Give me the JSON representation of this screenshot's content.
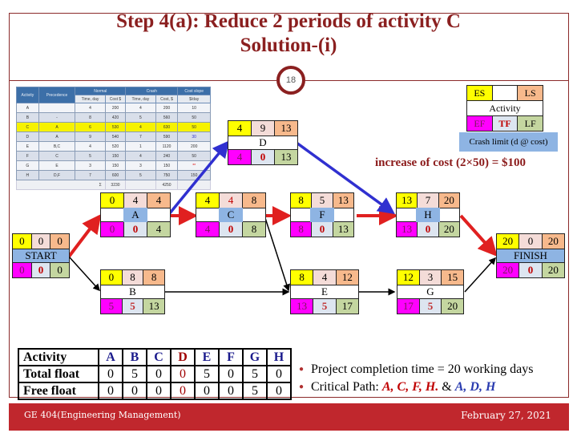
{
  "title": {
    "line1": "Step 4(a): Reduce 2 periods of activity C",
    "line2": "Solution-(i)"
  },
  "slide_number": "18",
  "cost_table": {
    "headers": [
      "Activity",
      "Precedence",
      "Normal",
      "Crash",
      "Cost slope"
    ],
    "subheaders": [
      "Time, day",
      "Cost $",
      "Time, day",
      "Cost, $",
      "$/day"
    ],
    "rows": [
      {
        "activity": "A",
        "precedence": "",
        "n_time": "4",
        "n_cost": "200",
        "c_time": "4",
        "c_cost": "200",
        "slope": "10"
      },
      {
        "activity": "B",
        "precedence": "-",
        "n_time": "8",
        "n_cost": "420",
        "c_time": "5",
        "c_cost": "560",
        "slope": "50"
      },
      {
        "activity": "C",
        "precedence": "A",
        "n_time": "6",
        "n_cost": "530",
        "c_time": "4",
        "c_cost": "630",
        "slope": "50"
      },
      {
        "activity": "D",
        "precedence": "A",
        "n_time": "9",
        "n_cost": "540",
        "c_time": "7",
        "c_cost": "590",
        "slope": "30"
      },
      {
        "activity": "E",
        "precedence": "B,C",
        "n_time": "4",
        "n_cost": "520",
        "c_time": "1",
        "c_cost": "1120",
        "slope": "200"
      },
      {
        "activity": "F",
        "precedence": "C",
        "n_time": "5",
        "n_cost": "150",
        "c_time": "4",
        "c_cost": "240",
        "slope": "50"
      },
      {
        "activity": "G",
        "precedence": "E",
        "n_time": "3",
        "n_cost": "150",
        "c_time": "3",
        "c_cost": "150",
        "slope": "**"
      },
      {
        "activity": "H",
        "precedence": "D,F",
        "n_time": "7",
        "n_cost": "600",
        "c_time": "5",
        "c_cost": "750",
        "slope": "150"
      }
    ],
    "total_label": "Σ",
    "total_normal": "3230",
    "total_crash": "4250"
  },
  "legend": {
    "es": "ES",
    "ls": "LS",
    "activity": "Activity",
    "ef": "EF",
    "tf": "TF",
    "lf": "LF",
    "crash_limit": "Crash limit (d @ cost)"
  },
  "cost_note": "increase of cost (2×50) = $100",
  "nodes": {
    "start": {
      "name": "START",
      "es": "0",
      "dur": "0",
      "ls": "0",
      "ef": "0",
      "tf": "0",
      "lf": "0"
    },
    "A": {
      "name": "A",
      "es": "0",
      "dur": "4",
      "ls": "4",
      "ef": "0",
      "tf": "0",
      "lf": "4"
    },
    "C": {
      "name": "C",
      "es": "4",
      "dur": "4",
      "ls": "8",
      "ef": "4",
      "tf": "0",
      "lf": "8"
    },
    "D": {
      "name": "D",
      "es": "4",
      "dur": "9",
      "ls": "13",
      "ef": "4",
      "tf": "0",
      "lf": "13"
    },
    "F": {
      "name": "F",
      "es": "8",
      "dur": "5",
      "ls": "13",
      "ef": "8",
      "tf": "0",
      "lf": "13"
    },
    "H": {
      "name": "H",
      "es": "13",
      "dur": "7",
      "ls": "20",
      "ef": "13",
      "tf": "0",
      "lf": "20"
    },
    "B": {
      "name": "B",
      "es": "0",
      "dur": "8",
      "ls": "8",
      "ef": "5",
      "tf": "5",
      "lf": "13"
    },
    "E": {
      "name": "E",
      "es": "8",
      "dur": "4",
      "ls": "12",
      "ef": "13",
      "tf": "5",
      "lf": "17"
    },
    "G": {
      "name": "G",
      "es": "12",
      "dur": "3",
      "ls": "15",
      "ef": "17",
      "tf": "5",
      "lf": "20"
    },
    "finish": {
      "name": "FINISH",
      "es": "20",
      "dur": "0",
      "ls": "20",
      "ef": "20",
      "tf": "0",
      "lf": "20"
    }
  },
  "float_table": {
    "row_labels": [
      "Activity",
      "Total float",
      "Free float"
    ],
    "activities": [
      "A",
      "B",
      "C",
      "D",
      "E",
      "F",
      "G",
      "H"
    ],
    "total_float": [
      "0",
      "5",
      "0",
      "0",
      "5",
      "0",
      "5",
      "0"
    ],
    "free_float": [
      "0",
      "0",
      "0",
      "0",
      "0",
      "0",
      "5",
      "0"
    ]
  },
  "bullets": {
    "completion": "Project completion time = 20 working days",
    "critical_prefix": "Critical Path: ",
    "critical_red": "A, C, F, H.",
    "critical_amp": " & ",
    "critical_blue": "A, D, H"
  },
  "footer": {
    "course": "GE 404(Engineering Management)",
    "date": "February 27, 2021"
  },
  "colors": {
    "title": "#8b2020",
    "footer_bg": "#c0272d",
    "es": "#ffff00",
    "ls": "#f7b98c",
    "ef": "#ff00ff",
    "tf": "#dde5f0",
    "lf": "#c4d6a0",
    "critical_red": "#e02020",
    "critical_blue": "#3030d0"
  }
}
